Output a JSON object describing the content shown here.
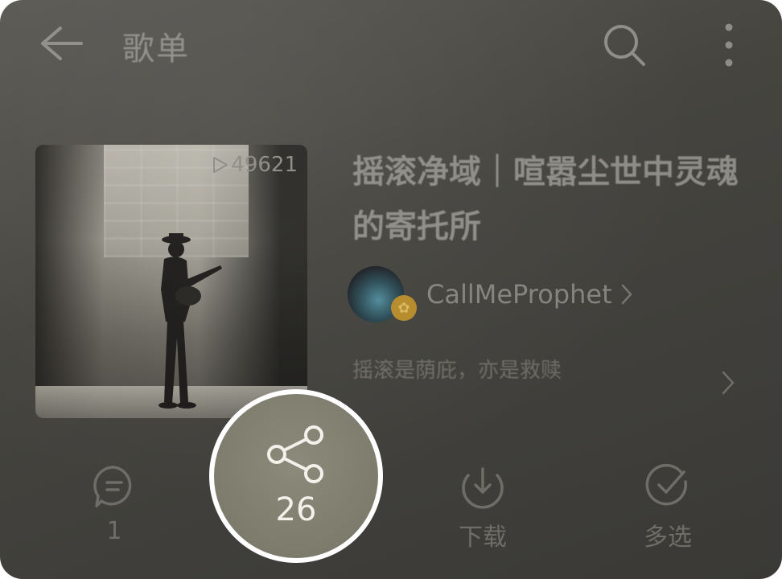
{
  "header": {
    "title": "歌单"
  },
  "playlist": {
    "play_count": "49621",
    "title": "摇滚净域｜喧嚣尘世中灵魂的寄托所",
    "creator": "CallMeProphet",
    "description": "摇滚是荫庇，亦是救赎"
  },
  "actions": {
    "comment_count": "1",
    "share_count": "26",
    "download_label": "下载",
    "multi_select_label": "多选"
  }
}
